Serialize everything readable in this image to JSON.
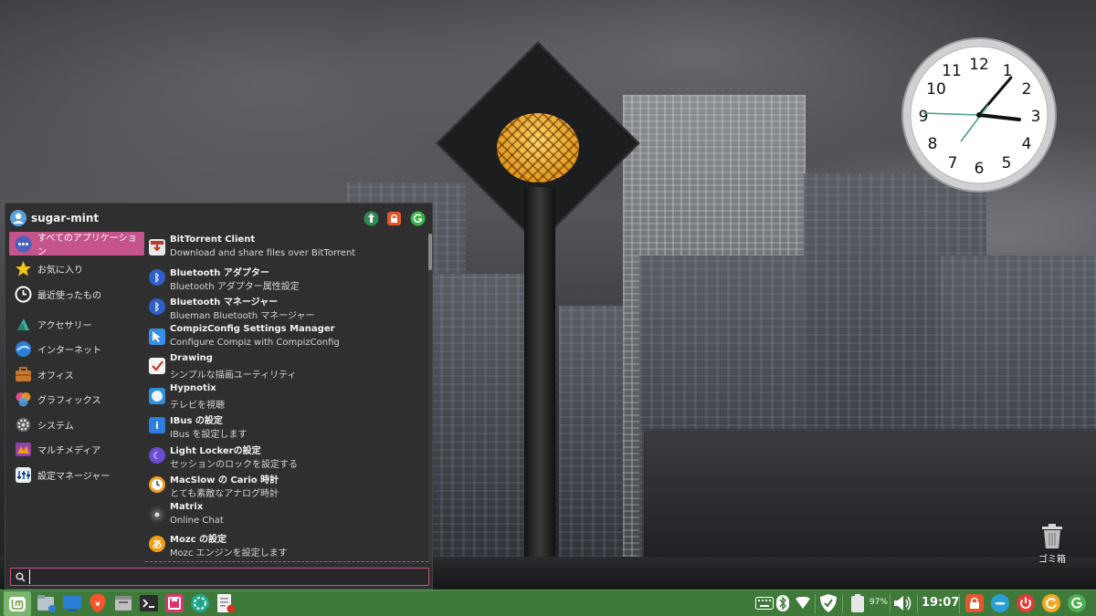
{
  "menu": {
    "user_name": "sugar-mint",
    "categories": [
      {
        "label": "すべてのアプリケーション",
        "icon": "all-apps-icon"
      },
      {
        "label": "お気に入り",
        "icon": "star-icon"
      },
      {
        "label": "最近使ったもの",
        "icon": "clock-icon"
      },
      {
        "label": "アクセサリー",
        "icon": "accessories-icon"
      },
      {
        "label": "インターネット",
        "icon": "internet-icon"
      },
      {
        "label": "オフィス",
        "icon": "briefcase-icon"
      },
      {
        "label": "グラフィックス",
        "icon": "graphics-icon"
      },
      {
        "label": "システム",
        "icon": "gear-icon"
      },
      {
        "label": "マルチメディア",
        "icon": "multimedia-icon"
      },
      {
        "label": "設定マネージャー",
        "icon": "settings-icon"
      }
    ],
    "apps": [
      {
        "name": "BitTorrent Client",
        "desc": "Download and share files over BitTorrent",
        "icon": "bittorrent-icon"
      },
      {
        "name": "Bluetooth アダプター",
        "desc": "Bluetooth アダプター属性設定",
        "icon": "bluetooth-icon"
      },
      {
        "name": "Bluetooth マネージャー",
        "desc": "Blueman Bluetooth マネージャー",
        "icon": "bluetooth-icon"
      },
      {
        "name": "CompizConfig Settings Manager",
        "desc": "Configure Compiz with CompizConfig",
        "icon": "compiz-icon"
      },
      {
        "name": "Drawing",
        "desc": "シンプルな描画ユーティリティ",
        "icon": "drawing-icon"
      },
      {
        "name": "Hypnotix",
        "desc": "テレビを視聴",
        "icon": "hypnotix-icon"
      },
      {
        "name": "IBus の設定",
        "desc": "IBus を設定します",
        "icon": "ibus-icon"
      },
      {
        "name": "Light Lockerの設定",
        "desc": "セッションのロックを設定する",
        "icon": "lock-icon"
      },
      {
        "name": "MacSlow の Cario 時計",
        "desc": "とても素敵なアナログ時計",
        "icon": "analog-clock-icon"
      },
      {
        "name": "Matrix",
        "desc": "Online Chat",
        "icon": "matrix-icon"
      },
      {
        "name": "Mozc の設定",
        "desc": "Mozc エンジンを設定します",
        "icon": "mozc-icon"
      }
    ],
    "search_value": ""
  },
  "desktop": {
    "trash_label": "ゴミ箱"
  },
  "taskbar": {
    "battery_percent": "97%",
    "time": "19:07"
  },
  "colors": {
    "accent": "#c6548c",
    "taskbar": "#3f7a3a"
  }
}
